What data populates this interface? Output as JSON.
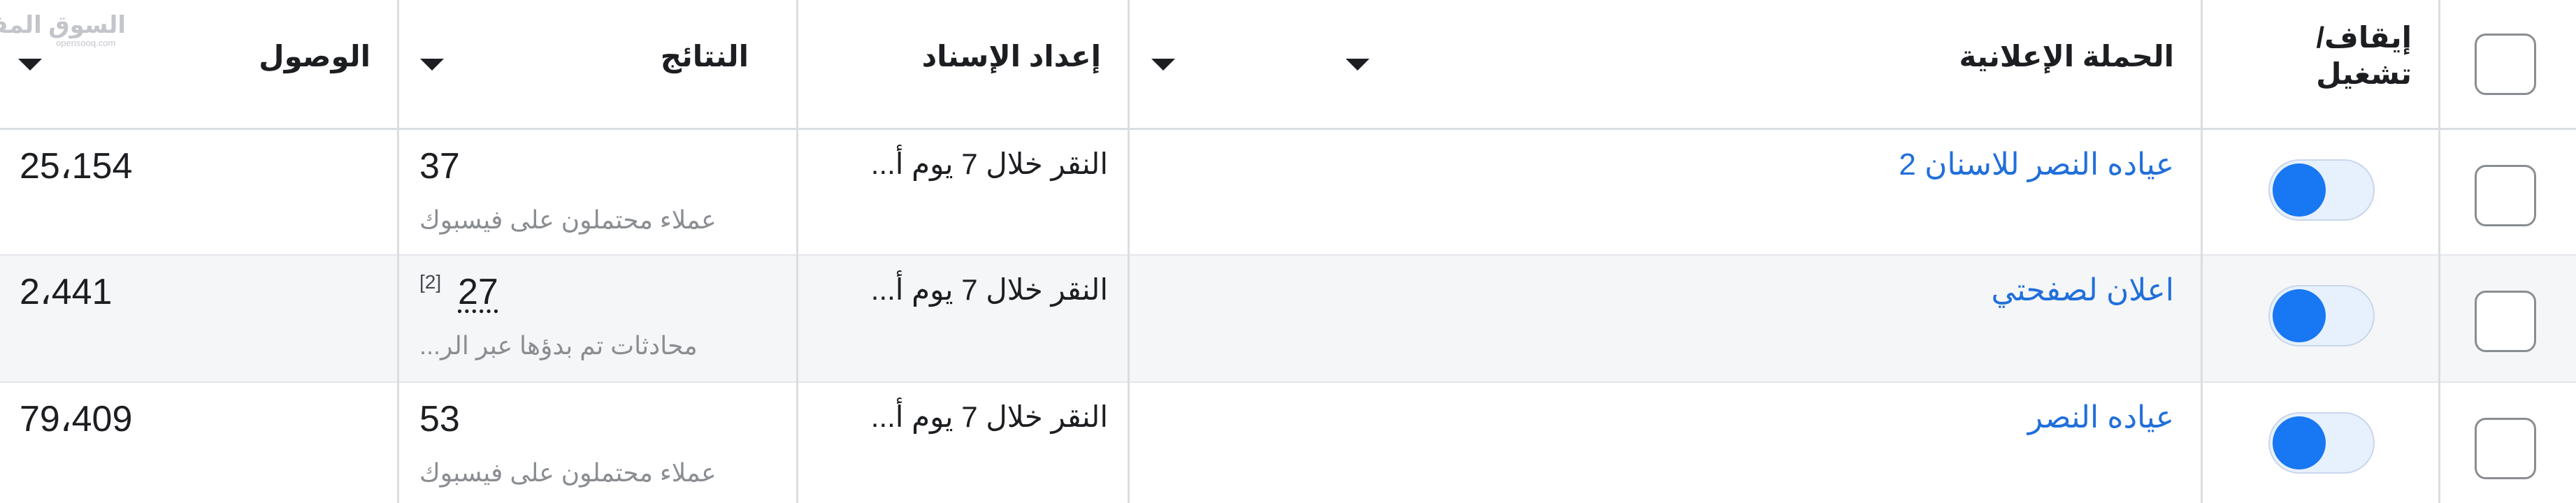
{
  "watermark": {
    "main": "السوق المفتوح",
    "sub": "opensooq.com"
  },
  "header": {
    "toggle_label_line1": "إيقاف/",
    "toggle_label_line2": "تشغيل",
    "campaign": "الحملة الإعلانية",
    "attribution": "إعداد الإسناد",
    "results": "النتائج",
    "reach": "الوصول"
  },
  "rows": [
    {
      "campaign_name": "عياده النصر للاسنان 2",
      "attribution": "النقر خلال 7 يوم أ...",
      "results_value": "37",
      "results_note": "",
      "results_subtitle": "عملاء محتملون على فيسبوك",
      "reach": "25،154",
      "toggle_on": true
    },
    {
      "campaign_name": "اعلان لصفحتي",
      "attribution": "النقر خلال 7 يوم أ...",
      "results_value": "27",
      "results_note": "[2]",
      "results_subtitle": "محادثات تم بدؤها عبر الر...",
      "reach": "2،441",
      "toggle_on": true
    },
    {
      "campaign_name": "عياده النصر",
      "attribution": "النقر خلال 7 يوم أ...",
      "results_value": "53",
      "results_note": "",
      "results_subtitle": "عملاء محتملون على فيسبوك",
      "reach": "79،409",
      "toggle_on": true
    }
  ],
  "colors": {
    "accent": "#1877f2",
    "link": "#216fdb",
    "toggle_track": "#e7f0fd",
    "row_highlight": "#f5f6f7",
    "border": "#dadde1"
  }
}
